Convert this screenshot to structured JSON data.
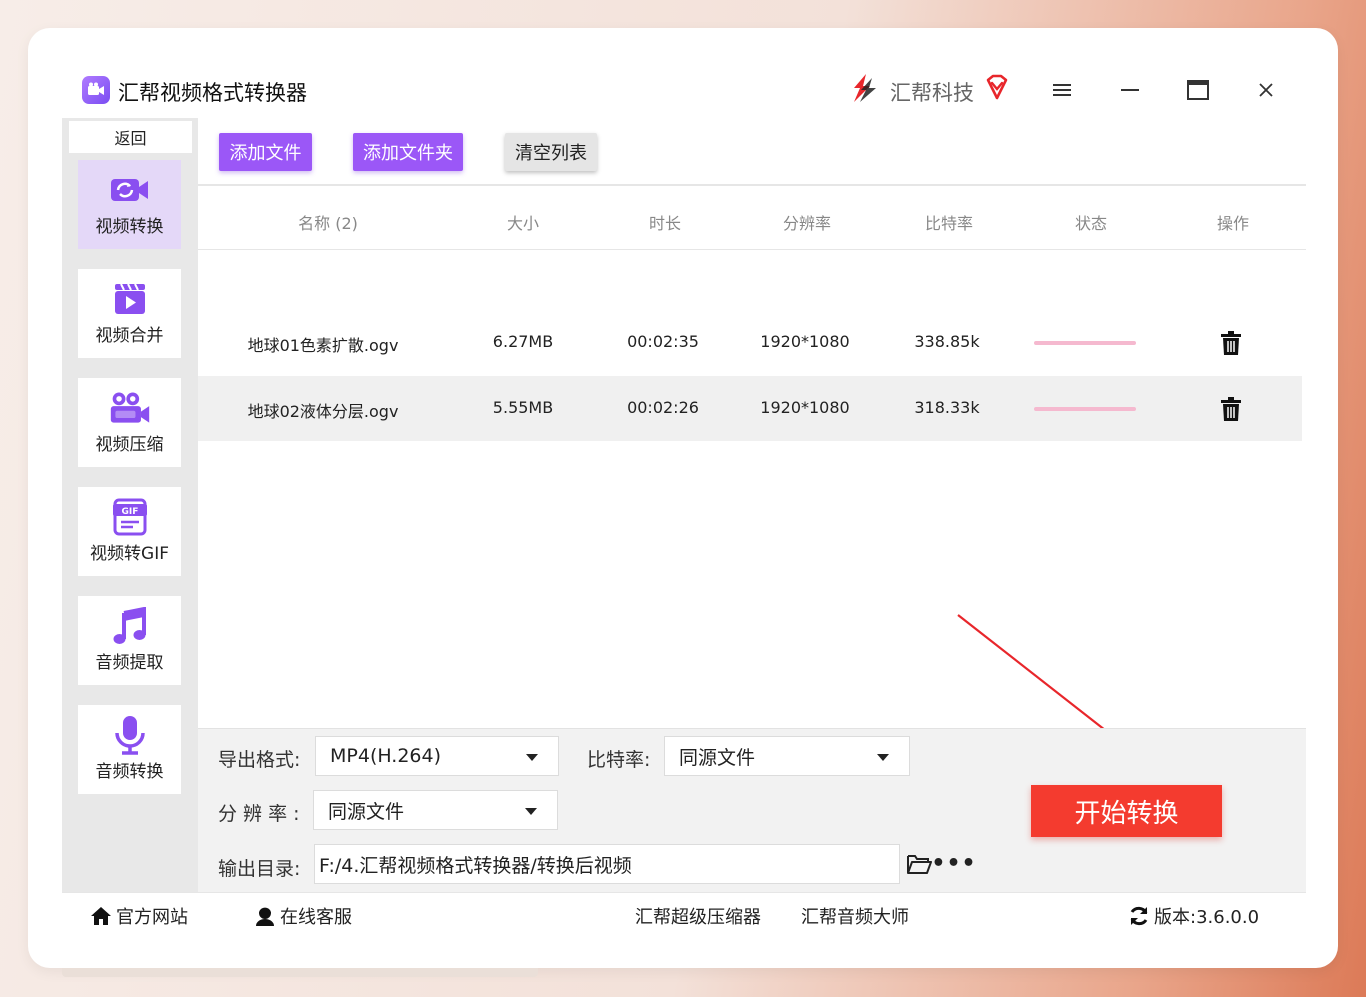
{
  "app": {
    "title": "汇帮视频格式转换器",
    "brand": "汇帮科技"
  },
  "sidebar": {
    "back": "返回",
    "items": [
      {
        "label": "视频转换",
        "icon": "video-convert-icon",
        "active": true
      },
      {
        "label": "视频合并",
        "icon": "video-merge-icon",
        "active": false
      },
      {
        "label": "视频压缩",
        "icon": "video-compress-icon",
        "active": false
      },
      {
        "label": "视频转GIF",
        "icon": "gif-icon",
        "active": false
      },
      {
        "label": "音频提取",
        "icon": "music-note-icon",
        "active": false
      },
      {
        "label": "音频转换",
        "icon": "microphone-icon",
        "active": false
      }
    ]
  },
  "toolbar": {
    "add_file": "添加文件",
    "add_folder": "添加文件夹",
    "clear_list": "清空列表"
  },
  "table": {
    "headers": [
      "名称 (2)",
      "大小",
      "时长",
      "分辨率",
      "比特率",
      "状态",
      "操作"
    ],
    "rows": [
      {
        "name": "地球01色素扩散.ogv",
        "size": "6.27MB",
        "duration": "00:02:35",
        "resolution": "1920*1080",
        "bitrate": "338.85k",
        "progress": 0
      },
      {
        "name": "地球02液体分层.ogv",
        "size": "5.55MB",
        "duration": "00:02:26",
        "resolution": "1920*1080",
        "bitrate": "318.33k",
        "progress": 0
      }
    ]
  },
  "settings": {
    "format_label": "导出格式:",
    "format_value": "MP4(H.264)",
    "bitrate_label": "比特率:",
    "bitrate_value": "同源文件",
    "resolution_label": "分 辨 率 :",
    "resolution_value": "同源文件",
    "output_label": "输出目录:",
    "output_path": "F:/4.汇帮视频格式转换器/转换后视频",
    "start_button": "开始转换"
  },
  "footer": {
    "website": "官方网站",
    "support": "在线客服",
    "compressor": "汇帮超级压缩器",
    "audio_master": "汇帮音频大师",
    "version": "版本:3.6.0.0"
  },
  "colors": {
    "accent_purple": "#9b57f7",
    "start_red": "#f43b2f",
    "progress_pink": "#f5b9cf",
    "sidebar_active": "#e4d8f8"
  }
}
